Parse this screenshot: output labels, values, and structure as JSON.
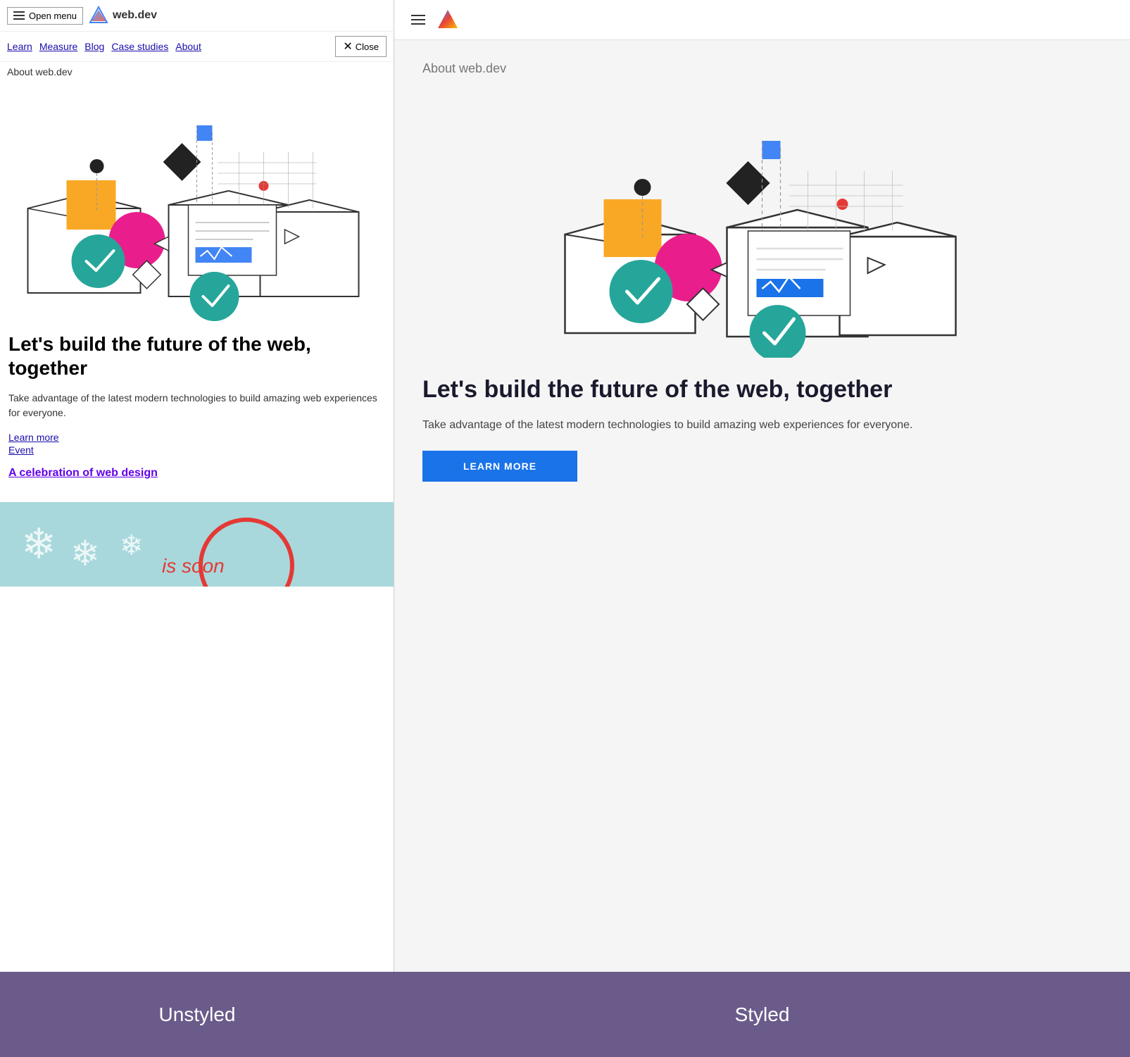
{
  "header": {
    "open_menu": "Open menu",
    "site_name": "web.dev",
    "close": "Close"
  },
  "nav": {
    "items": [
      "Learn",
      "Measure",
      "Blog",
      "Case studies",
      "About"
    ]
  },
  "about_label": "About web.dev",
  "heading": "Let's build the future of the web, together",
  "description": "Take advantage of the latest modern technologies to build amazing web experiences for everyone.",
  "links": {
    "learn_more": "Learn more",
    "event": "Event",
    "celebration": "A celebration of web design"
  },
  "learn_more_button": "LEARN MORE",
  "labels": {
    "unstyled": "Unstyled",
    "styled": "Styled"
  }
}
